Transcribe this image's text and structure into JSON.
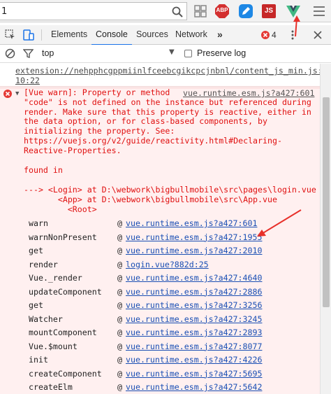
{
  "browser": {
    "address_text": "1",
    "extensions": [
      "grid-icon",
      "adblock-icon",
      "pencil-icon",
      "js-icon",
      "vue-devtools-icon"
    ],
    "adblock_label": "ABP",
    "js_label": "JS"
  },
  "devtools": {
    "tabs": [
      "Elements",
      "Console",
      "Sources",
      "Network"
    ],
    "more": "»",
    "active_tab": "Console",
    "error_count": "4"
  },
  "console_toolbar": {
    "context": "top",
    "preserve_log": "Preserve log"
  },
  "messages": {
    "prev_line1": "extension://nehpphcgppmiinlfceebcgikcpcjnbnl/content_js_min.js:",
    "prev_line2": "10:22",
    "source_link": "vue.runtime.esm.js?a427:601",
    "warn_lines": [
      "[Vue warn]: Property or method",
      "\"code\" is not defined on the instance but referenced during",
      "render. Make sure that this property is reactive, either in",
      "the data option, or for class-based components, by",
      "initializing the property. See:",
      "https://vuejs.org/v2/guide/reactivity.html#Declaring-",
      "Reactive-Properties."
    ],
    "found_in": "found in",
    "components": [
      "---> <Login> at D:\\webwork\\bigbullmobile\\src\\pages\\login.vue",
      "       <App> at D:\\webwork\\bigbullmobile\\src\\App.vue",
      "         <Root>"
    ]
  },
  "stack": [
    {
      "fn": "warn",
      "loc": "vue.runtime.esm.js?a427:601"
    },
    {
      "fn": "warnNonPresent",
      "loc": "vue.runtime.esm.js?a427:1955"
    },
    {
      "fn": "get",
      "loc": "vue.runtime.esm.js?a427:2010"
    },
    {
      "fn": "render",
      "loc": "login.vue?882d:25"
    },
    {
      "fn": "Vue._render",
      "loc": "vue.runtime.esm.js?a427:4640"
    },
    {
      "fn": "updateComponent",
      "loc": "vue.runtime.esm.js?a427:2886"
    },
    {
      "fn": "get",
      "loc": "vue.runtime.esm.js?a427:3256"
    },
    {
      "fn": "Watcher",
      "loc": "vue.runtime.esm.js?a427:3245"
    },
    {
      "fn": "mountComponent",
      "loc": "vue.runtime.esm.js?a427:2893"
    },
    {
      "fn": "Vue.$mount",
      "loc": "vue.runtime.esm.js?a427:8077"
    },
    {
      "fn": "init",
      "loc": "vue.runtime.esm.js?a427:4226"
    },
    {
      "fn": "createComponent",
      "loc": "vue.runtime.esm.js?a427:5695"
    },
    {
      "fn": "createElm",
      "loc": "vue.runtime.esm.js?a427:5642"
    }
  ],
  "stack_at": "@",
  "colors": {
    "error_red": "#e01010",
    "link_blue": "#1a4fb4",
    "annotation_red": "#e8302a",
    "vue_green": "#41b883"
  }
}
